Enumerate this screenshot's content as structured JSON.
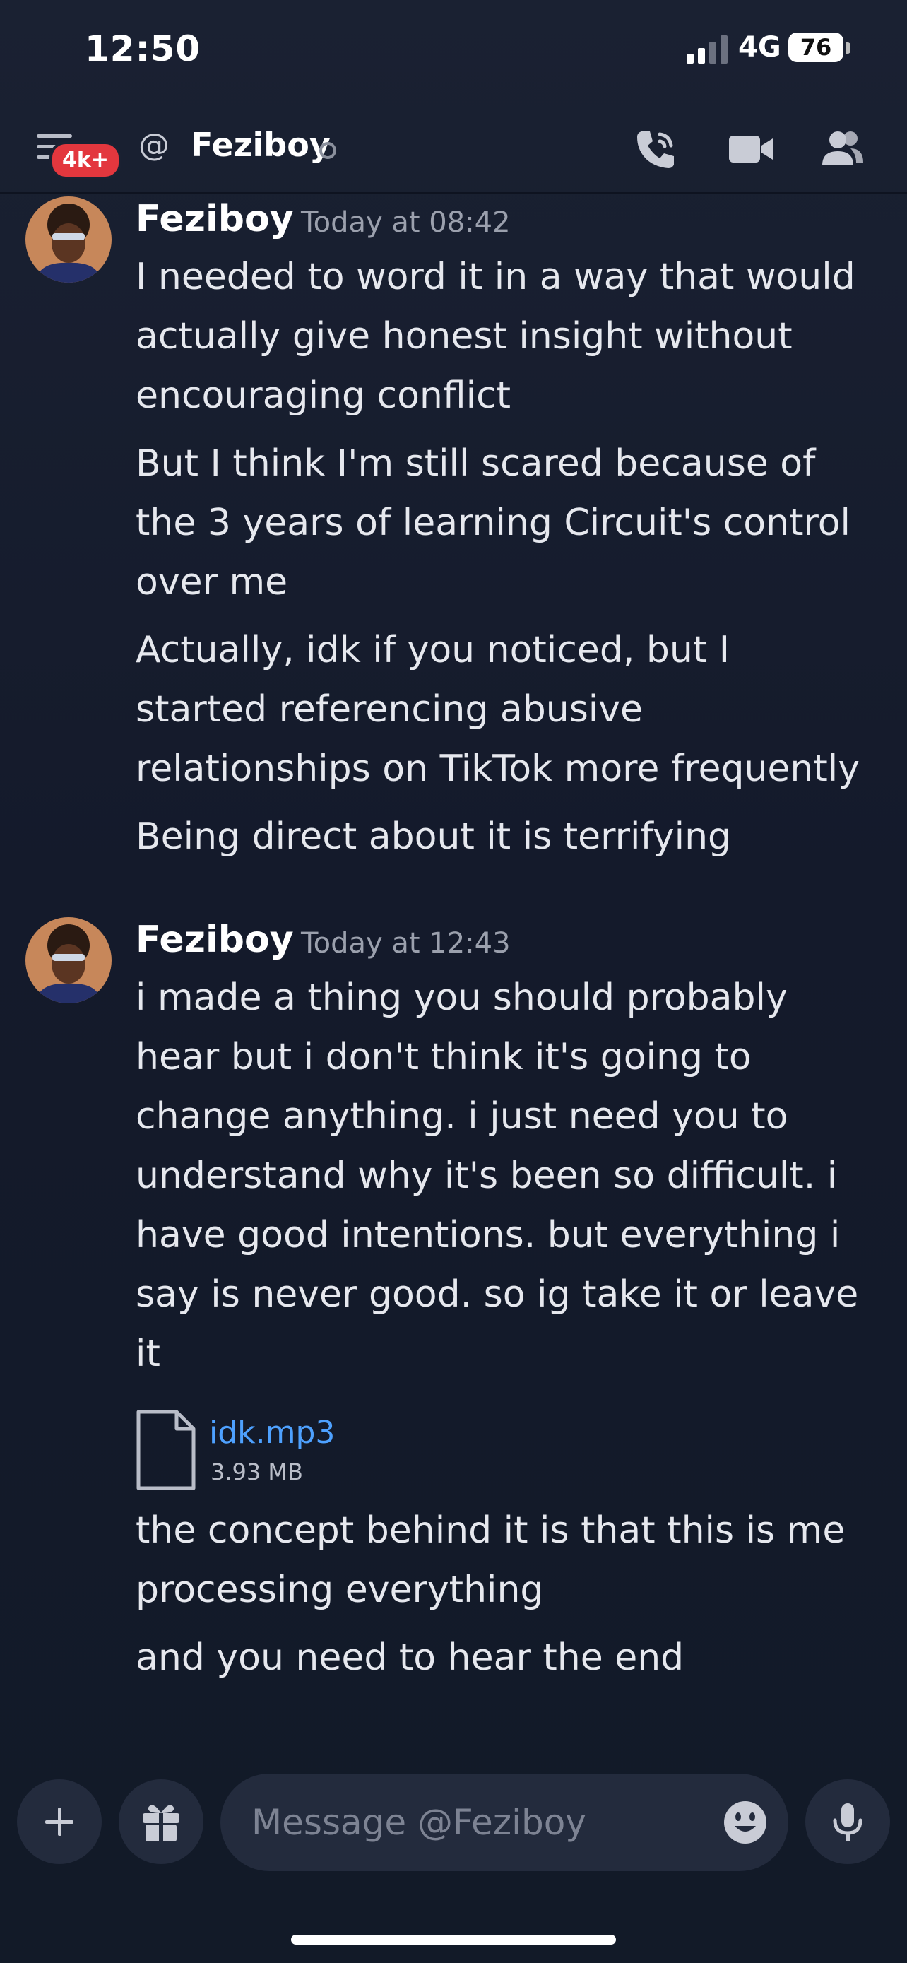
{
  "status_bar": {
    "time": "12:50",
    "network": "4G",
    "battery": "76"
  },
  "header": {
    "badge": "4k+",
    "title": "Feziboy"
  },
  "messages": [
    {
      "author": "Feziboy",
      "timestamp": "Today at 08:42",
      "lines": [
        "I needed to word it in a way that would",
        "actually give honest insight without",
        "encouraging conflict",
        "But I think I'm still scared because of",
        "the 3 years of learning Circuit's control",
        "over me",
        "Actually, idk if you noticed, but I",
        "started referencing abusive",
        "relationships on TikTok more frequently",
        "Being direct about it is terrifying"
      ]
    },
    {
      "author": "Feziboy",
      "timestamp": "Today at 12:43",
      "lines": [
        "i made a thing you should probably",
        "hear but i don't think it's going to",
        "change anything. i just need you to",
        "understand why it's been so difficult. i",
        "have good intentions. but everything i",
        "say is never good. so ig take it or leave",
        "it"
      ],
      "attachment": {
        "name": "idk.mp3",
        "size": "3.93 MB"
      },
      "after_lines": [
        "the concept behind it is that this is me",
        "processing everything",
        "and you need to hear the end"
      ]
    }
  ],
  "composer": {
    "placeholder": "Message @Feziboy"
  },
  "icons": {
    "signal": "signal-bars-icon",
    "menu": "menu-icon",
    "at": "at-sign-icon",
    "call": "phone-call-icon",
    "video": "video-camera-icon",
    "members": "members-icon",
    "file": "file-icon",
    "add": "plus-icon",
    "gift": "gift-icon",
    "emoji": "emoji-icon",
    "mic": "microphone-icon"
  },
  "colors": {
    "background": "#141a2b",
    "badge": "#e3373e",
    "link": "#4ea1ff",
    "muted": "#9ba0ad"
  }
}
